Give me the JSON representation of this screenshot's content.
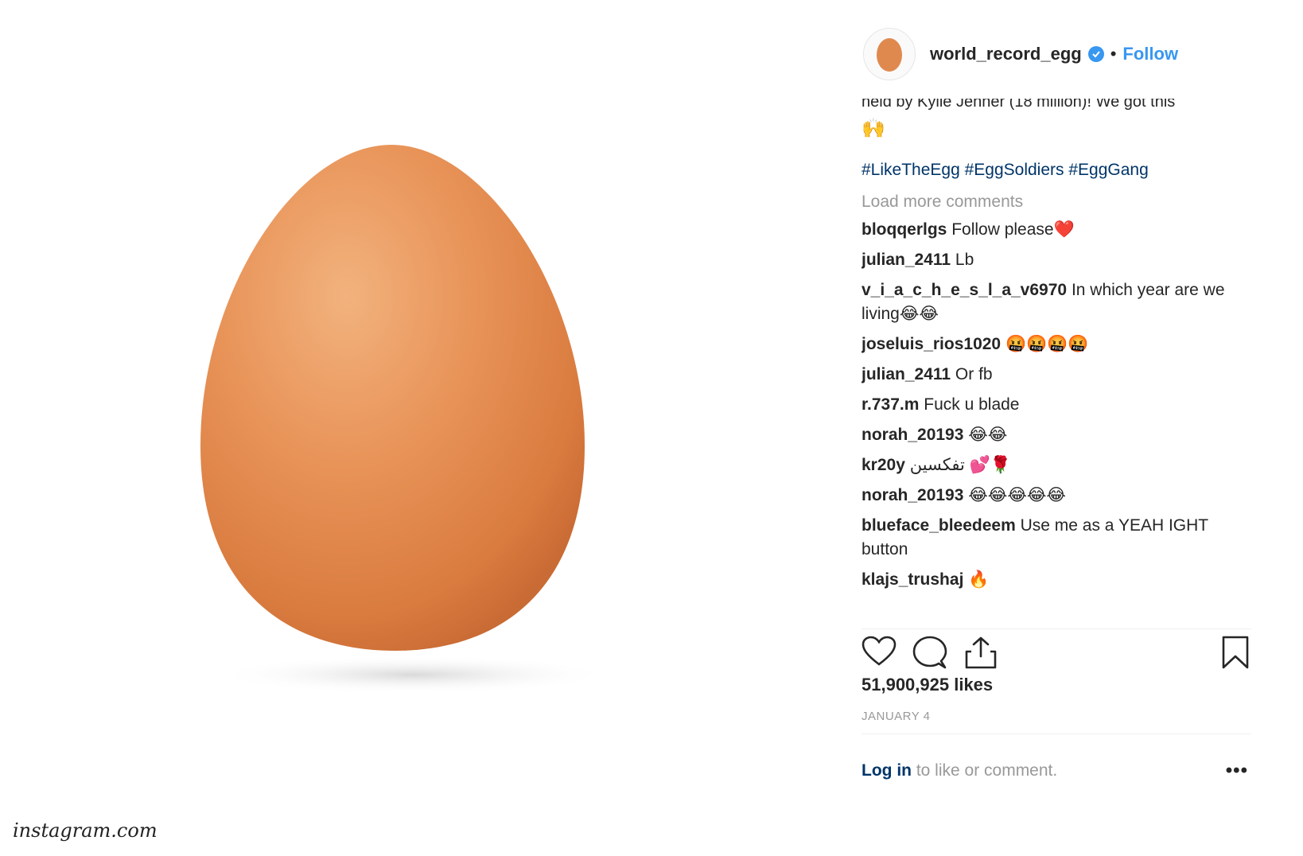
{
  "post": {
    "username": "world_record_egg",
    "follow_label": "Follow",
    "separator": "•",
    "caption_tail": "held by Kylie Jenner (18 million)! We got this",
    "caption_emoji": "🙌",
    "hashtags": [
      "#LikeTheEgg",
      "#EggSoldiers",
      "#EggGang"
    ],
    "load_more": "Load more comments",
    "comments": [
      {
        "user": "bloqqerlgs",
        "text": "Follow please❤️"
      },
      {
        "user": "julian_2411",
        "text": "Lb"
      },
      {
        "user": "v_i_a_c_h_e_s_l_a_v6970",
        "text": "In which year are we living😂😂"
      },
      {
        "user": "joseluis_rios1020",
        "text": "🤬🤬🤬🤬"
      },
      {
        "user": "julian_2411",
        "text": "Or fb"
      },
      {
        "user": "r.737.m",
        "text": "Fuck u blade"
      },
      {
        "user": "norah_20193",
        "text": "😂😂"
      },
      {
        "user": "kr20y",
        "text": "تفكسين 💕🌹"
      },
      {
        "user": "norah_20193",
        "text": "😂😂😂😂😂"
      },
      {
        "user": "blueface_bleedeem",
        "text": "Use me as a YEAH IGHT button"
      },
      {
        "user": "klajs_trushaj",
        "text": "🔥"
      }
    ],
    "likes": "51,900,925 likes",
    "date": "JANUARY 4",
    "login_link": "Log in",
    "login_rest": " to like or comment.",
    "more": "•••"
  },
  "icons": {
    "like": "heart-icon",
    "comment": "comment-icon",
    "share": "share-icon",
    "save": "bookmark-icon",
    "verified": "verified-badge-icon"
  },
  "colors": {
    "egg_main": "#e0894f",
    "egg_highlight": "#f2b27d",
    "egg_shadow": "#c96b34",
    "link_blue": "#3897f0",
    "hashtag": "#003569",
    "muted": "#999999"
  },
  "watermark": "instagram.com"
}
